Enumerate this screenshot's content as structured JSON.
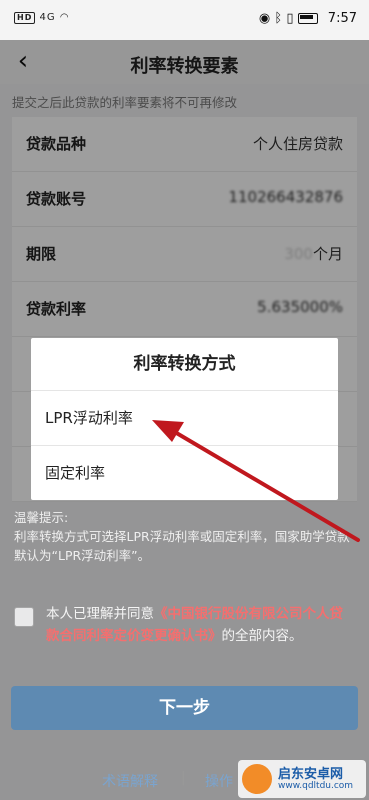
{
  "status": {
    "time": "7:57",
    "hd": "HD",
    "net": "4G"
  },
  "nav": {
    "title": "利率转换要素"
  },
  "note": "提交之后此贷款的利率要素将不可再修改",
  "rows": [
    {
      "label": "贷款品种",
      "value": "个人住房贷款"
    },
    {
      "label": "贷款账号",
      "value": "110266432876"
    },
    {
      "label": "期限",
      "value": "300",
      "unit": "个月"
    },
    {
      "label": "贷款利率",
      "value": "5.635000%"
    }
  ],
  "dialog": {
    "title": "利率转换方式",
    "options": [
      "LPR浮动利率",
      "固定利率"
    ]
  },
  "tips": {
    "title": "温馨提示:",
    "body": "利率转换方式可选择LPR浮动利率或固定利率，国家助学贷款默认为“LPR浮动利率”。"
  },
  "agree": {
    "prefix": "本人已理解并同意",
    "link": "《中国银行股份有限公司个人贷款合同利率定价变更确认书》",
    "suffix": "的全部内容。"
  },
  "next_label": "下一步",
  "footer": {
    "terms": "术语解释",
    "sep": "|",
    "ops": "操作"
  },
  "watermark": {
    "name": "启东安卓网",
    "url": "www.qdltdu.com"
  },
  "colors": {
    "primary": "#5e8ab2",
    "link": "#ff6b6b",
    "arrow": "#c0181e"
  }
}
